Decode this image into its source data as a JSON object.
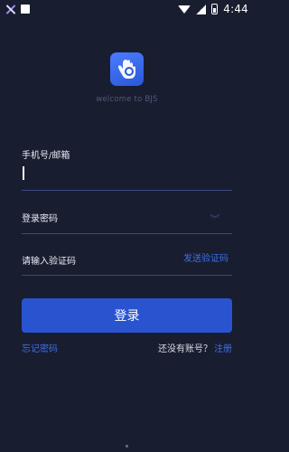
{
  "status_bar": {
    "time": "4:44"
  },
  "brand": {
    "welcome_text": "welcome to BJS"
  },
  "form": {
    "phone_email_label": "手机号/邮箱",
    "password_label": "登录密码",
    "code_label": "请输入验证码",
    "send_code_label": "发送验证码",
    "login_button": "登录"
  },
  "footer": {
    "forgot_password": "忘记密码",
    "no_account": "还没有账号？",
    "register": "注册"
  },
  "colors": {
    "background": "#181d30",
    "accent": "#2a54cf",
    "link": "#3f6fe6"
  }
}
